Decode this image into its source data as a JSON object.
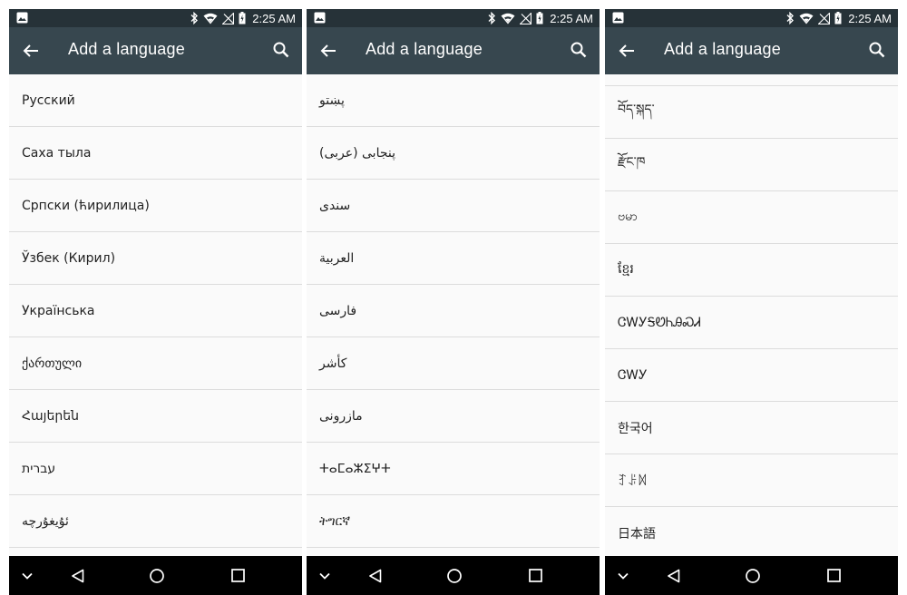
{
  "screens": [
    {
      "status": {
        "time": "2:25 AM"
      },
      "appbar": {
        "title": "Add a language"
      },
      "languages": [
        "Русский",
        "Саха тыла",
        "Српски (ћирилица)",
        "Ўзбек (Кирил)",
        "Українська",
        "ქართული",
        "Հայերեն",
        "עברית",
        "ئۇيغۇرچە"
      ]
    },
    {
      "status": {
        "time": "2:25 AM"
      },
      "appbar": {
        "title": "Add a language"
      },
      "languages": [
        "پښتو",
        "پنجابی (عربی)",
        "سندی",
        "العربية",
        "فارسی",
        "کأشر",
        "مازرونی",
        "ⵜⴰⵎⴰⵣⵉⵖⵜ",
        "ትግርኛ"
      ]
    },
    {
      "status": {
        "time": "2:25 AM"
      },
      "appbar": {
        "title": "Add a language"
      },
      "languages": [
        "བོད་སྐད་",
        "རྫོང་ཁ",
        "ဗမာ",
        "ខ្មែរ",
        "ᏣᎳᎩᎦᏬᏂᎯᏍᏗ",
        "ᏣᎳᎩ",
        "한국어",
        "ꆈꌠꉙ",
        "日本語"
      ]
    }
  ],
  "icons": {
    "status_left": "image-notification-icon",
    "bluetooth": "bluetooth-icon",
    "wifi": "wifi-icon",
    "signal": "no-signal-icon",
    "battery": "battery-charging-icon",
    "back": "arrow-back-icon",
    "search": "search-icon",
    "nav_chevron": "chevron-down-icon",
    "nav_back": "nav-back-icon",
    "nav_home": "nav-home-icon",
    "nav_recent": "nav-recents-icon"
  },
  "colors": {
    "statusbar": "#263238",
    "appbar": "#37474f",
    "list_bg": "#fafafa",
    "divider": "#dcdcdc",
    "navbar": "#000000"
  }
}
